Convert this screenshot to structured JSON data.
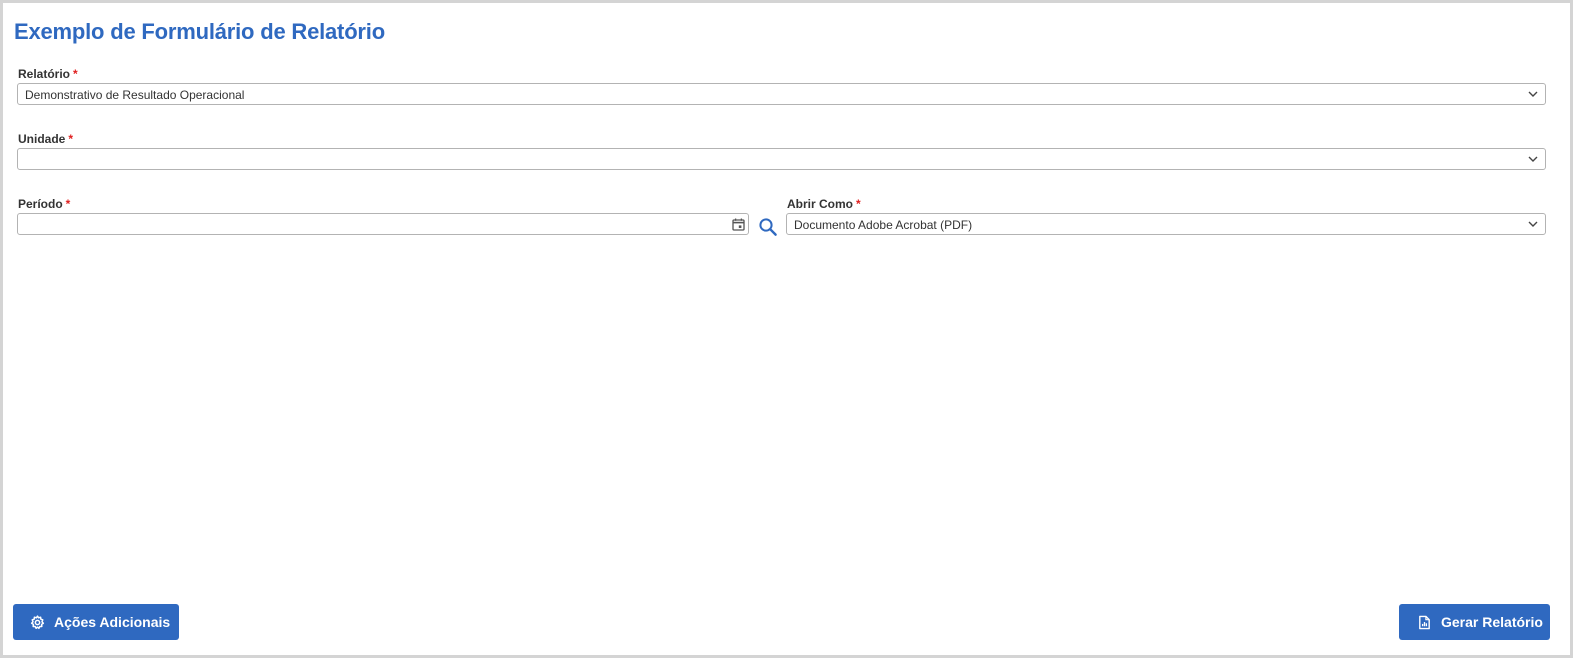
{
  "page": {
    "title": "Exemplo de Formulário de Relatório"
  },
  "form": {
    "relatorio": {
      "label": "Relatório",
      "required_marker": "*",
      "value": "Demonstrativo de Resultado Operacional"
    },
    "unidade": {
      "label": "Unidade",
      "required_marker": "*",
      "value": ""
    },
    "periodo": {
      "label": "Período",
      "required_marker": "*",
      "value": ""
    },
    "abrir_como": {
      "label": "Abrir Como",
      "required_marker": "*",
      "value": "Documento Adobe Acrobat (PDF)"
    }
  },
  "footer": {
    "extra_actions_label": "Ações Adicionais",
    "generate_label": "Gerar Relatório"
  },
  "colors": {
    "accent": "#2f69c0",
    "required": "#e02020",
    "border": "#b3b3b3"
  },
  "icons": {
    "select_arrow": "chevron-down-icon",
    "date_picker": "calendar-icon",
    "search": "search-icon",
    "extra_actions": "gear-icon",
    "generate": "file-chart-icon"
  }
}
